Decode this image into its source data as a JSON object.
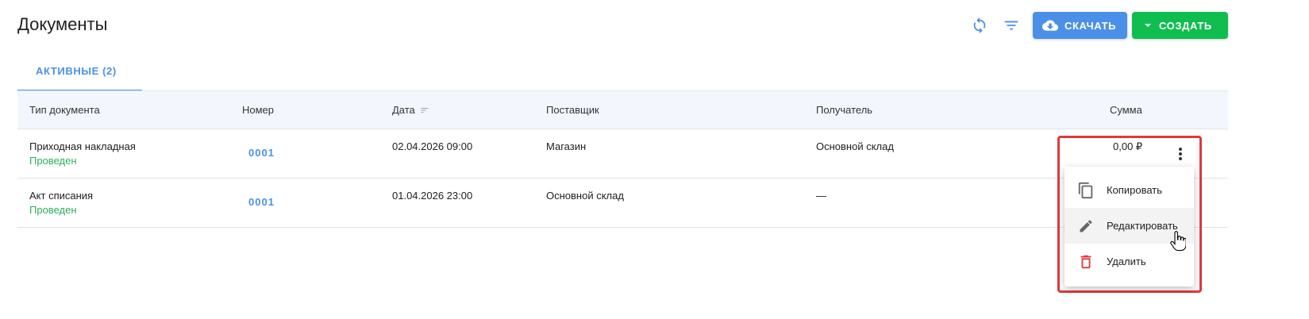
{
  "page": {
    "title": "Документы"
  },
  "toolbar": {
    "refresh_icon": "refresh-icon",
    "filter_icon": "filter-icon",
    "download_label": "СКАЧАТЬ",
    "create_label": "СОЗДАТЬ",
    "download_color": "#4a90e8",
    "create_color": "#0fbe4f"
  },
  "tabs": [
    {
      "label": "АКТИВНЫЕ (2)",
      "active": true
    }
  ],
  "table": {
    "headers": {
      "type": "Тип документа",
      "number": "Номер",
      "date": "Дата",
      "supplier": "Поставщик",
      "receiver": "Получатель",
      "sum": "Сумма"
    },
    "rows": [
      {
        "type": "Приходная накладная",
        "status": "Проведен",
        "number": "0001",
        "date": "02.04.2026 09:00",
        "supplier": "Магазин",
        "receiver": "Основной склад",
        "sum": "0,00 ₽"
      },
      {
        "type": "Акт списания",
        "status": "Проведен",
        "number": "0001",
        "date": "01.04.2026 23:00",
        "supplier": "Основной склад",
        "receiver": "—",
        "sum": ""
      }
    ]
  },
  "context_menu": {
    "items": [
      {
        "label": "Копировать",
        "icon": "copy-icon"
      },
      {
        "label": "Редактировать",
        "icon": "edit-icon"
      },
      {
        "label": "Удалить",
        "icon": "delete-icon"
      }
    ]
  },
  "colors": {
    "accent": "#4a90e8",
    "success": "#2fae58",
    "danger": "#e0383e"
  }
}
